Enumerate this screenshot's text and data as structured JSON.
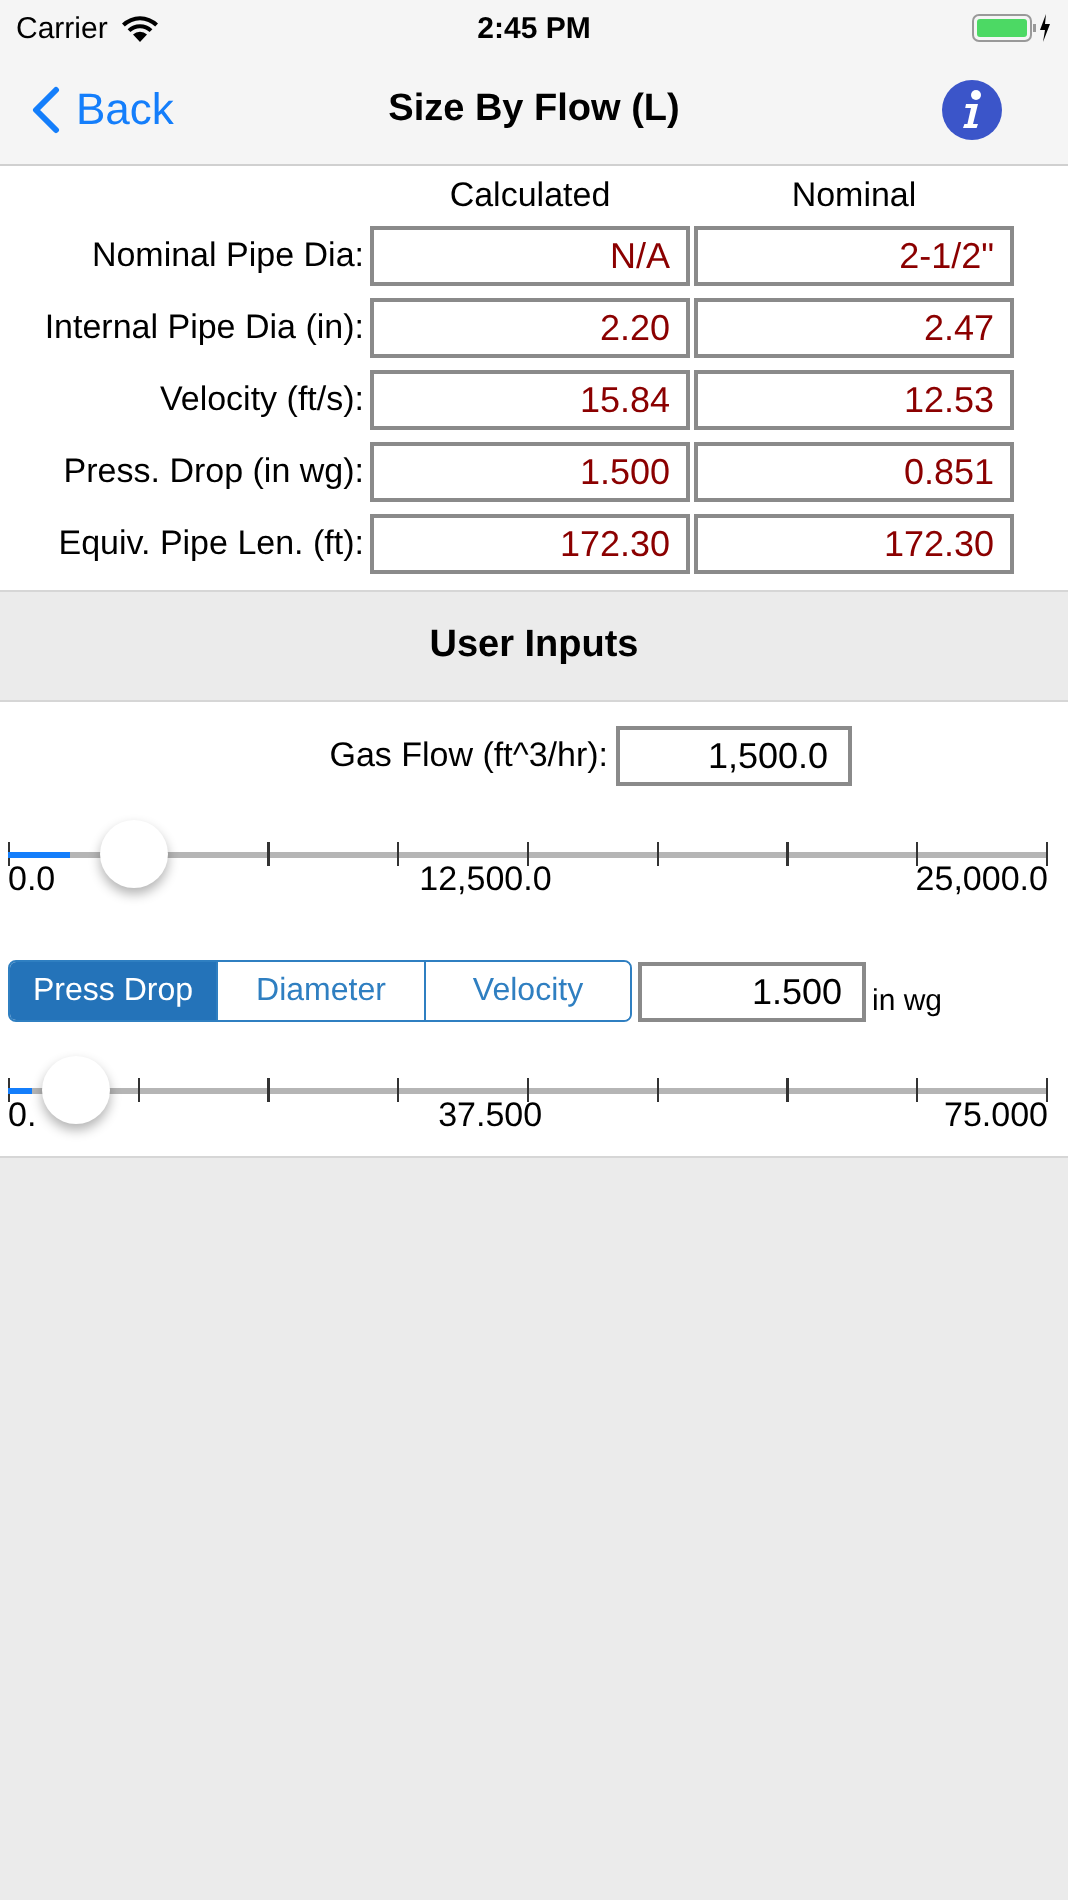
{
  "status_bar": {
    "carrier": "Carrier",
    "time": "2:45 PM"
  },
  "nav": {
    "back": "Back",
    "title": "Size By Flow (L)"
  },
  "results": {
    "columns": [
      "Calculated",
      "Nominal"
    ],
    "rows": [
      {
        "label": "Nominal Pipe Dia:",
        "calculated": "N/A",
        "nominal": "2-1/2\""
      },
      {
        "label": "Internal Pipe Dia (in):",
        "calculated": "2.20",
        "nominal": "2.47"
      },
      {
        "label": "Velocity (ft/s):",
        "calculated": "15.84",
        "nominal": "12.53"
      },
      {
        "label": "Press. Drop (in wg):",
        "calculated": "1.500",
        "nominal": "0.851"
      },
      {
        "label": "Equiv. Pipe Len. (ft):",
        "calculated": "172.30",
        "nominal": "172.30"
      }
    ]
  },
  "inputs": {
    "title": "User Inputs",
    "gas_flow": {
      "label": "Gas Flow (ft^3/hr):",
      "value": "1,500.0"
    },
    "flow_slider": {
      "level": 0.06,
      "min": "0.0",
      "mid": "12,500.0",
      "max": "25,000.0"
    },
    "segments": [
      {
        "label": "Press Drop",
        "selected": true
      },
      {
        "label": "Diameter",
        "selected": false
      },
      {
        "label": "Velocity",
        "selected": false
      }
    ],
    "target": {
      "value": "1.500",
      "unit": "in wg"
    },
    "target_slider": {
      "level": 0.02,
      "min": "0.",
      "mid": "37.500",
      "max": "75.000"
    }
  }
}
